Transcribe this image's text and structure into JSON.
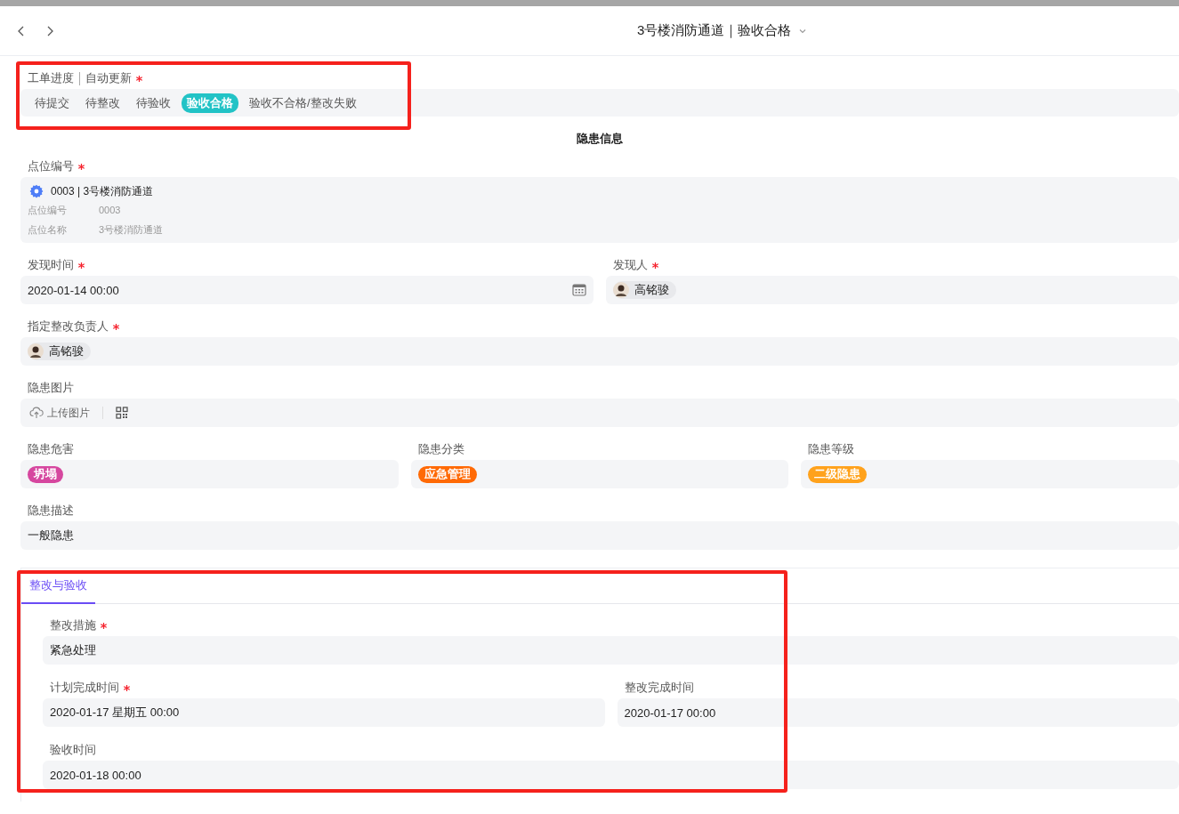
{
  "header": {
    "title": "3号楼消防通道｜验收合格"
  },
  "progress": {
    "label": "工单进度",
    "sublabel": "自动更新",
    "required": true,
    "highlighted": true,
    "steps": [
      {
        "label": "待提交",
        "selected": false
      },
      {
        "label": "待整改",
        "selected": false
      },
      {
        "label": "待验收",
        "selected": false
      },
      {
        "label": "验收合格",
        "selected": true
      },
      {
        "label": "验收不合格/整改失败",
        "selected": false
      }
    ]
  },
  "section_title": "隐患信息",
  "form_rows": [
    [
      {
        "kind": "point",
        "label": "点位编号",
        "required": true,
        "value": "0003 | 3号楼消防通道",
        "details": [
          {
            "label": "点位编号",
            "value": "0003"
          },
          {
            "label": "点位名称",
            "value": "3号楼消防通道"
          }
        ]
      }
    ],
    [
      {
        "kind": "date",
        "label": "发现时间",
        "required": true,
        "value": "2020-01-14 00:00"
      },
      {
        "kind": "person",
        "label": "发现人",
        "required": true,
        "value": "高铭骏"
      }
    ],
    [
      {
        "kind": "person",
        "label": "指定整改负责人",
        "required": true,
        "value": "高铭骏"
      }
    ],
    [
      {
        "kind": "upload",
        "label": "隐患图片",
        "required": false,
        "value": "上传图片"
      }
    ],
    [
      {
        "kind": "tag",
        "label": "隐患危害",
        "required": false,
        "value": "坍塌",
        "color": "#d6479f"
      },
      {
        "kind": "tag",
        "label": "隐患分类",
        "required": false,
        "value": "应急管理",
        "color": "#ff6a06"
      },
      {
        "kind": "tag",
        "label": "隐患等级",
        "required": false,
        "value": "二级隐患",
        "color": "#ffa21c"
      }
    ],
    [
      {
        "kind": "text",
        "label": "隐患描述",
        "required": false,
        "value": "一般隐患"
      }
    ]
  ],
  "tab_section": {
    "highlighted": true,
    "tabs": [
      {
        "label": "整改与验收",
        "selected": true
      }
    ],
    "rows": [
      [
        {
          "kind": "text",
          "label": "整改措施",
          "required": true,
          "value": "紧急处理"
        }
      ],
      [
        {
          "kind": "text",
          "label": "计划完成时间",
          "required": true,
          "value": "2020-01-17 星期五 00:00"
        },
        {
          "kind": "text",
          "label": "整改完成时间",
          "required": false,
          "value": "2020-01-17 00:00"
        }
      ],
      [
        {
          "kind": "text",
          "label": "验收时间",
          "required": false,
          "value": "2020-01-18 00:00"
        }
      ]
    ]
  }
}
